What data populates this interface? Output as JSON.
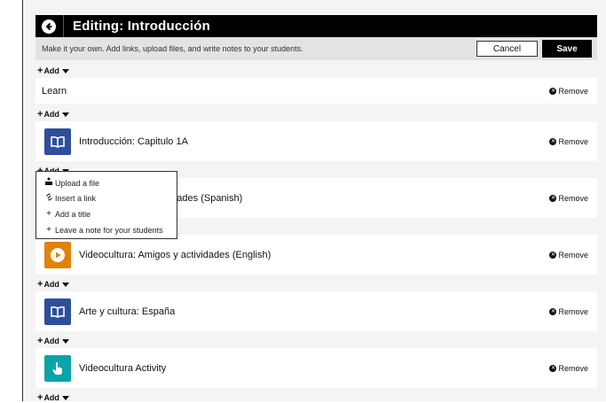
{
  "header": {
    "title": "Editing: Introducción"
  },
  "subbar": {
    "description": "Make it your own. Add links, upload files, and write notes to your students.",
    "cancel_label": "Cancel",
    "save_label": "Save"
  },
  "add_label": "Add",
  "remove_label": "Remove",
  "rows": [
    {
      "title": "Learn",
      "icon": "none"
    },
    {
      "title": "Introducción: Capitulo 1A",
      "icon": "book-icon",
      "color": "#2e4f99"
    },
    {
      "title": "Videocultura: Amigos y actividades (Spanish)",
      "visible_title": "s y actividades (Spanish)",
      "icon": "play-icon",
      "color": "#e0820c"
    },
    {
      "title": "Videocultura: Amigos y actividades (English)",
      "icon": "play-icon",
      "color": "#e0820c"
    },
    {
      "title": "Arte y cultura: España",
      "icon": "book-icon",
      "color": "#2e4f99"
    },
    {
      "title": "Videocultura Activity",
      "icon": "hand-pointer-icon",
      "color": "#0aa3a8"
    }
  ],
  "add_menu": {
    "items": [
      {
        "label": "Upload a file",
        "icon": "upload-icon"
      },
      {
        "label": "Insert a link",
        "icon": "link-icon"
      },
      {
        "label": "Add a title",
        "icon": "plus-icon"
      },
      {
        "label": "Leave a note for your students",
        "icon": "plus-icon"
      }
    ]
  },
  "colors": {
    "header_bg": "#000000",
    "book_blue": "#2e4f99",
    "video_orange": "#e0820c",
    "activity_teal": "#0aa3a8"
  }
}
